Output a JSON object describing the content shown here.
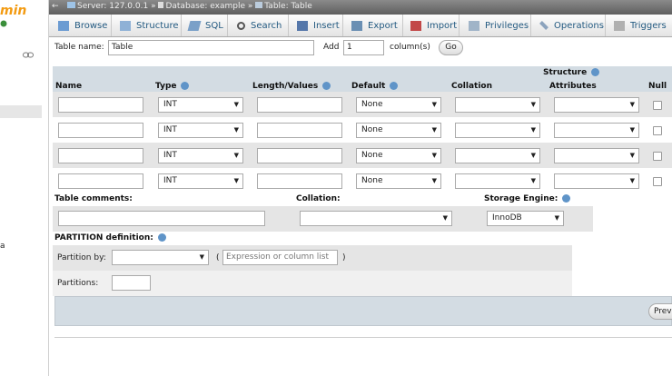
{
  "left_panel": {
    "logo_text": "min",
    "item_text": "a"
  },
  "breadcrumb": {
    "server": "Server: 127.0.0.1",
    "database": "Database: example",
    "table": "Table: Table",
    "separator": "»"
  },
  "menu": {
    "tabs": [
      {
        "label": "Browse",
        "icon": "browse-icon"
      },
      {
        "label": "Structure",
        "icon": "structure-icon"
      },
      {
        "label": "SQL",
        "icon": "sql-icon"
      },
      {
        "label": "Search",
        "icon": "search-icon"
      },
      {
        "label": "Insert",
        "icon": "insert-icon"
      },
      {
        "label": "Export",
        "icon": "export-icon"
      },
      {
        "label": "Import",
        "icon": "import-icon"
      },
      {
        "label": "Privileges",
        "icon": "privileges-icon"
      },
      {
        "label": "Operations",
        "icon": "operations-icon"
      },
      {
        "label": "Triggers",
        "icon": "triggers-icon"
      }
    ]
  },
  "table_name": {
    "label": "Table name:",
    "value": "Table"
  },
  "add_columns": {
    "label": "Add",
    "value": "1",
    "suffix": "column(s)",
    "go": "Go"
  },
  "structure": {
    "title": "Structure",
    "headers": {
      "name": "Name",
      "type": "Type",
      "length": "Length/Values",
      "default": "Default",
      "collation": "Collation",
      "attributes": "Attributes",
      "null": "Null"
    },
    "rows": [
      {
        "type": "INT",
        "default": "None"
      },
      {
        "type": "INT",
        "default": "None"
      },
      {
        "type": "INT",
        "default": "None"
      },
      {
        "type": "INT",
        "default": "None"
      }
    ]
  },
  "table_options": {
    "comments_label": "Table comments:",
    "collation_label": "Collation:",
    "engine_label": "Storage Engine:",
    "engine_value": "InnoDB"
  },
  "partition": {
    "title": "PARTITION definition:",
    "by_label": "Partition by:",
    "open_paren": "(",
    "expression_placeholder": "Expression or column list",
    "close_paren": ")",
    "partitions_label": "Partitions:"
  },
  "footer": {
    "preview_label": "Prev"
  }
}
